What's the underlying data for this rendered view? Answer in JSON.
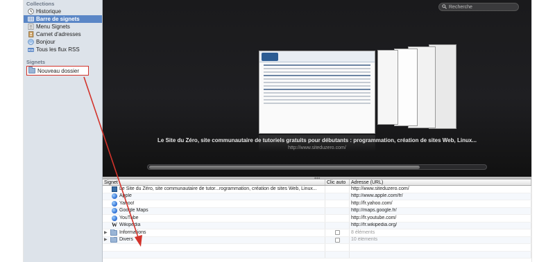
{
  "sidebar": {
    "collections_header": "Collections",
    "collections": [
      {
        "label": "Historique",
        "icon": "clock-icon"
      },
      {
        "label": "Barre de signets",
        "icon": "bookmarks-bar-icon",
        "selected": true
      },
      {
        "label": "Menu Signets",
        "icon": "bookmarks-menu-icon"
      },
      {
        "label": "Carnet d'adresses",
        "icon": "address-book-icon"
      },
      {
        "label": "Bonjour",
        "icon": "bonjour-icon"
      },
      {
        "label": "Tous les flux RSS",
        "icon": "rss-icon"
      }
    ],
    "signets_header": "Signets",
    "new_folder": "Nouveau dossier"
  },
  "coverflow": {
    "search_placeholder": "Recherche",
    "title": "Le Site du Zéro, site communautaire de tutoriels gratuits pour débutants : programmation, création de sites Web, Linux...",
    "url": "http://www.siteduzero.com/"
  },
  "table": {
    "columns": [
      "Signet",
      "Clic auto",
      "Adresse (URL)"
    ],
    "rows": [
      {
        "name": "Le Site du Zéro, site communautaire de tutor...rogrammation, création de sites Web, Linux...",
        "url": "http://www.siteduzero.com/",
        "icon": "sdz"
      },
      {
        "name": "Apple",
        "url": "http://www.apple.com/fr/",
        "icon": "globe"
      },
      {
        "name": "Yahoo!",
        "url": "http://fr.yahoo.com/",
        "icon": "globe"
      },
      {
        "name": "Google Maps",
        "url": "http://maps.google.fr/",
        "icon": "globe"
      },
      {
        "name": "YouTube",
        "url": "http://fr.youtube.com/",
        "icon": "globe"
      },
      {
        "name": "Wikipedia",
        "url": "http://fr.wikipedia.org/",
        "icon": "wikipedia"
      },
      {
        "name": "Informations",
        "url": "8 éléments",
        "icon": "folder",
        "folder": true
      },
      {
        "name": "Divers",
        "url": "10 éléments",
        "icon": "folder",
        "folder": true
      }
    ]
  },
  "colors": {
    "selection": "#5a86c6",
    "annotation": "#d2332b"
  }
}
